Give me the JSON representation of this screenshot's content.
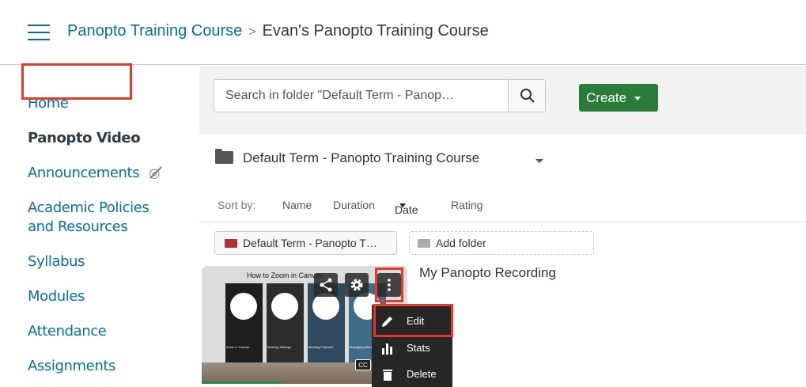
{
  "breadcrumb": {
    "course": "Panopto Training Course",
    "current": "Evan's Panopto Training Course"
  },
  "sidebar": {
    "items": [
      {
        "label": "Home"
      },
      {
        "label": "Panopto Video",
        "active": true
      },
      {
        "label": "Announcements"
      },
      {
        "label": "Academic Policies"
      },
      {
        "label": "and Resources"
      },
      {
        "label": "Syllabus"
      },
      {
        "label": "Modules"
      },
      {
        "label": "Attendance"
      },
      {
        "label": "Assignments"
      }
    ]
  },
  "panopto": {
    "search_placeholder": "Search in folder \"Default Term - Panop…",
    "create_label": "Create",
    "folder_name": "Default Term - Panopto Training Course",
    "sort": {
      "label": "Sort by:",
      "options": [
        "Name",
        "Duration",
        "Date",
        "Rating"
      ],
      "active": "Date"
    },
    "folder_chip": "Default Term - Panopto T…",
    "add_folder": "Add folder",
    "video": {
      "title": "My Panopto Recording",
      "thumbnail_title": "How to Zoom in Canvas",
      "captions": [
        "Zoom in Canvas",
        "Meeting Settings",
        "Meeting Features",
        "Managing Attendees"
      ],
      "cc": "CC"
    },
    "menu": {
      "items": [
        "Edit",
        "Stats",
        "Delete"
      ]
    }
  },
  "colors": {
    "link": "#0770a3",
    "highlight": "#e23b2b",
    "create": "#2a7d39",
    "menu_bg": "#262626"
  },
  "icons": [
    "hamburger-icon",
    "eye-off-icon",
    "search-icon",
    "folder-icon",
    "share-icon",
    "gear-icon",
    "more-vertical-icon",
    "pencil-icon",
    "bar-chart-icon",
    "trash-icon"
  ]
}
